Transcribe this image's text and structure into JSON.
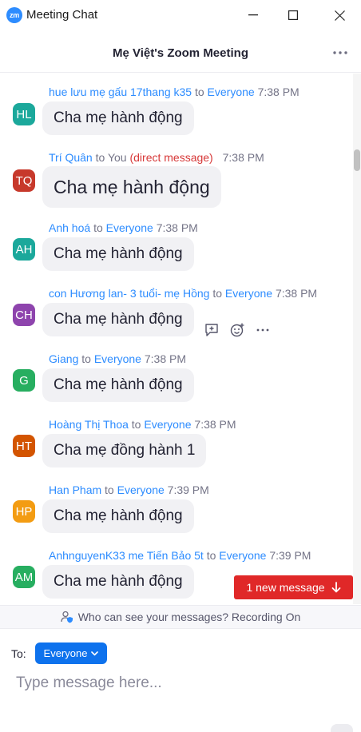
{
  "window": {
    "logo_text": "zm",
    "title": "Meeting Chat"
  },
  "header": {
    "title": "Mẹ Việt's Zoom Meeting"
  },
  "messages": [
    {
      "initials": "HL",
      "avatar_color": "#1ba89b",
      "sender": "hue lưu mẹ gấu 17thang k35",
      "to_word": "to",
      "recipient": "Everyone",
      "time": "7:38 PM",
      "text": "Cha mẹ hành động"
    },
    {
      "initials": "TQ",
      "avatar_color": "#c7392b",
      "sender": "Trí Quân",
      "to_word": "to",
      "recipient": "You",
      "direct_label": "(direct message)",
      "time": "7:38 PM",
      "text": "Cha mẹ hành động"
    },
    {
      "initials": "AH",
      "avatar_color": "#1ba89b",
      "sender": "Anh hoá",
      "to_word": "to",
      "recipient": "Everyone",
      "time": "7:38 PM",
      "text": "Cha mẹ hành động"
    },
    {
      "initials": "CH",
      "avatar_color": "#8e44ad",
      "sender": "con Hương lan- 3 tuổi- mẹ Hồng",
      "to_word": "to",
      "recipient": "Everyone",
      "time": "7:38 PM",
      "text": "Cha mẹ hành động"
    },
    {
      "initials": "G",
      "avatar_color": "#27ae60",
      "sender": "Giang",
      "to_word": "to",
      "recipient": "Everyone",
      "time": "7:38 PM",
      "text": "Cha mẹ hành động"
    },
    {
      "initials": "HT",
      "avatar_color": "#d35400",
      "sender": "Hoàng Thị Thoa",
      "to_word": "to",
      "recipient": "Everyone",
      "time": "7:38 PM",
      "text": "Cha mẹ đồng hành 1"
    },
    {
      "initials": "HP",
      "avatar_color": "#f39c12",
      "sender": "Han Pham",
      "to_word": "to",
      "recipient": "Everyone",
      "time": "7:39 PM",
      "text": "Cha mẹ hành động"
    },
    {
      "initials": "AM",
      "avatar_color": "#27ae60",
      "sender": "AnhnguyenK33 me Tiến Bảo 5t",
      "to_word": "to",
      "recipient": "Everyone",
      "time": "7:39 PM",
      "text": "Cha me hành động"
    }
  ],
  "new_message_button": {
    "label": "1 new message"
  },
  "notice": {
    "text": "Who can see your messages? Recording On"
  },
  "composer": {
    "to_label": "To:",
    "recipient": "Everyone",
    "placeholder": "Type message here..."
  },
  "colors": {
    "accent": "#2d8cff",
    "select_blue": "#0e72ed",
    "alert_red": "#e02828",
    "direct_red": "#d73838"
  }
}
